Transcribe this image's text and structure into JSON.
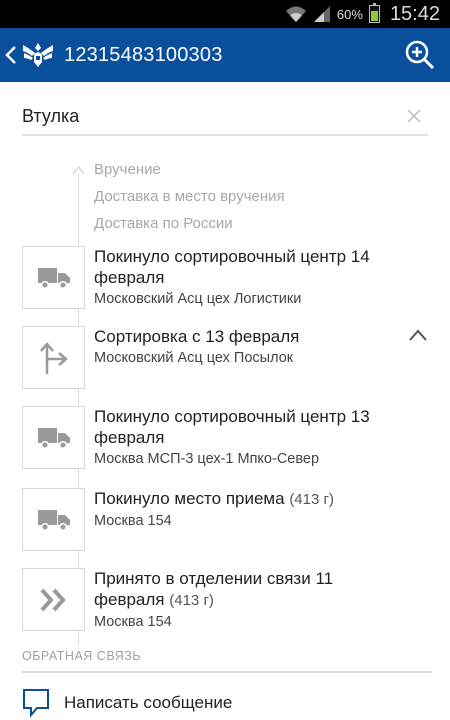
{
  "status_bar": {
    "battery": "60%",
    "battery_level": 0.6,
    "time": "15:42"
  },
  "header": {
    "tracking_number": "12315483100303"
  },
  "name_field": {
    "value": "Втулка"
  },
  "future_steps": [
    "Вручение",
    "Доставка в место вручения",
    "Доставка по России"
  ],
  "events": [
    {
      "icon": "truck-icon",
      "title": "Покинуло сортировочный центр 14 февраля",
      "weight": "",
      "place": "Московский Асц цех Логистики"
    },
    {
      "icon": "sort-arrow-icon",
      "title": "Сортировка с 13 февраля",
      "weight": "",
      "place": "Московский Асц цех Посылок"
    },
    {
      "icon": "truck-icon",
      "title": "Покинуло сортировочный центр 13 февраля",
      "weight": "",
      "place": "Москва МСП-3 цех-1 Мпко-Север"
    },
    {
      "icon": "truck-icon",
      "title": "Покинуло место приема",
      "weight": "(413 г)",
      "place": "Москва 154"
    },
    {
      "icon": "double-chevron-icon",
      "title": "Принято в отделении связи 11 февраля",
      "weight": "(413 г)",
      "place": "Москва 154"
    }
  ],
  "feedback": {
    "section_label": "ОБРАТНАЯ СВЯЗЬ",
    "write_label": "Написать сообщение"
  },
  "colors": {
    "app_bar": "#0a4f9c",
    "muted_text": "#a8a8a8",
    "icon_gray": "#9a9a9a"
  }
}
